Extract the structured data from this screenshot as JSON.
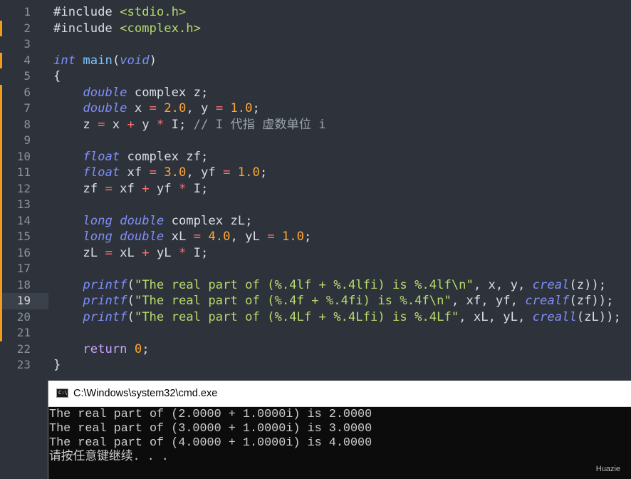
{
  "editor": {
    "current_line": "19",
    "lines": [
      {
        "num": "1",
        "marked": false,
        "tokens": [
          {
            "t": "#include ",
            "c": "pp"
          },
          {
            "t": "<stdio.h>",
            "c": "inc"
          }
        ]
      },
      {
        "num": "2",
        "marked": true,
        "tokens": [
          {
            "t": "#include ",
            "c": "pp"
          },
          {
            "t": "<complex.h>",
            "c": "inc"
          }
        ]
      },
      {
        "num": "3",
        "marked": false,
        "tokens": []
      },
      {
        "num": "4",
        "marked": true,
        "tokens": [
          {
            "t": "int",
            "c": "k"
          },
          {
            "t": " "
          },
          {
            "t": "main",
            "c": "fn"
          },
          {
            "t": "("
          },
          {
            "t": "void",
            "c": "k"
          },
          {
            "t": ")"
          }
        ]
      },
      {
        "num": "5",
        "marked": false,
        "tokens": [
          {
            "t": "{"
          }
        ]
      },
      {
        "num": "6",
        "marked": true,
        "tokens": [
          {
            "t": "    "
          },
          {
            "t": "double",
            "c": "k"
          },
          {
            "t": " complex z;"
          }
        ]
      },
      {
        "num": "7",
        "marked": true,
        "tokens": [
          {
            "t": "    "
          },
          {
            "t": "double",
            "c": "k"
          },
          {
            "t": " x "
          },
          {
            "t": "=",
            "c": "o"
          },
          {
            "t": " "
          },
          {
            "t": "2.0",
            "c": "n"
          },
          {
            "t": ", y "
          },
          {
            "t": "=",
            "c": "o"
          },
          {
            "t": " "
          },
          {
            "t": "1.0",
            "c": "n"
          },
          {
            "t": ";"
          }
        ]
      },
      {
        "num": "8",
        "marked": true,
        "tokens": [
          {
            "t": "    z "
          },
          {
            "t": "=",
            "c": "o"
          },
          {
            "t": " x "
          },
          {
            "t": "+",
            "c": "o"
          },
          {
            "t": " y "
          },
          {
            "t": "*",
            "c": "o"
          },
          {
            "t": " I; "
          },
          {
            "t": "// I 代指 虚数单位 i",
            "c": "cm"
          }
        ]
      },
      {
        "num": "9",
        "marked": true,
        "tokens": []
      },
      {
        "num": "10",
        "marked": true,
        "tokens": [
          {
            "t": "    "
          },
          {
            "t": "float",
            "c": "k"
          },
          {
            "t": " complex zf;"
          }
        ]
      },
      {
        "num": "11",
        "marked": true,
        "tokens": [
          {
            "t": "    "
          },
          {
            "t": "float",
            "c": "k"
          },
          {
            "t": " xf "
          },
          {
            "t": "=",
            "c": "o"
          },
          {
            "t": " "
          },
          {
            "t": "3.0",
            "c": "n"
          },
          {
            "t": ", yf "
          },
          {
            "t": "=",
            "c": "o"
          },
          {
            "t": " "
          },
          {
            "t": "1.0",
            "c": "n"
          },
          {
            "t": ";"
          }
        ]
      },
      {
        "num": "12",
        "marked": true,
        "tokens": [
          {
            "t": "    zf "
          },
          {
            "t": "=",
            "c": "o"
          },
          {
            "t": " xf "
          },
          {
            "t": "+",
            "c": "o"
          },
          {
            "t": " yf "
          },
          {
            "t": "*",
            "c": "o"
          },
          {
            "t": " I;"
          }
        ]
      },
      {
        "num": "13",
        "marked": true,
        "tokens": []
      },
      {
        "num": "14",
        "marked": true,
        "tokens": [
          {
            "t": "    "
          },
          {
            "t": "long",
            "c": "k"
          },
          {
            "t": " "
          },
          {
            "t": "double",
            "c": "k"
          },
          {
            "t": " complex zL;"
          }
        ]
      },
      {
        "num": "15",
        "marked": true,
        "tokens": [
          {
            "t": "    "
          },
          {
            "t": "long",
            "c": "k"
          },
          {
            "t": " "
          },
          {
            "t": "double",
            "c": "k"
          },
          {
            "t": " xL "
          },
          {
            "t": "=",
            "c": "o"
          },
          {
            "t": " "
          },
          {
            "t": "4.0",
            "c": "n"
          },
          {
            "t": ", yL "
          },
          {
            "t": "=",
            "c": "o"
          },
          {
            "t": " "
          },
          {
            "t": "1.0",
            "c": "n"
          },
          {
            "t": ";"
          }
        ]
      },
      {
        "num": "16",
        "marked": true,
        "tokens": [
          {
            "t": "    zL "
          },
          {
            "t": "=",
            "c": "o"
          },
          {
            "t": " xL "
          },
          {
            "t": "+",
            "c": "o"
          },
          {
            "t": " yL "
          },
          {
            "t": "*",
            "c": "o"
          },
          {
            "t": " I;"
          }
        ]
      },
      {
        "num": "17",
        "marked": true,
        "tokens": []
      },
      {
        "num": "18",
        "marked": true,
        "tokens": [
          {
            "t": "    "
          },
          {
            "t": "printf",
            "c": "k"
          },
          {
            "t": "("
          },
          {
            "t": "\"The real part of (%.4lf + %.4lfi) is %.4lf\\n\"",
            "c": "s"
          },
          {
            "t": ", x, y, "
          },
          {
            "t": "creal",
            "c": "k"
          },
          {
            "t": "(z));"
          }
        ]
      },
      {
        "num": "19",
        "marked": true,
        "tokens": [
          {
            "t": "    "
          },
          {
            "t": "printf",
            "c": "k"
          },
          {
            "t": "("
          },
          {
            "t": "\"The real part of (%.4f + %.4fi) is %.4f\\n\"",
            "c": "s"
          },
          {
            "t": ", xf, yf, "
          },
          {
            "t": "crealf",
            "c": "k"
          },
          {
            "t": "(zf));"
          }
        ]
      },
      {
        "num": "20",
        "marked": true,
        "tokens": [
          {
            "t": "    "
          },
          {
            "t": "printf",
            "c": "k"
          },
          {
            "t": "("
          },
          {
            "t": "\"The real part of (%.4Lf + %.4Lfi) is %.4Lf\"",
            "c": "s"
          },
          {
            "t": ", xL, yL, "
          },
          {
            "t": "creall",
            "c": "k"
          },
          {
            "t": "(zL));"
          }
        ]
      },
      {
        "num": "21",
        "marked": true,
        "tokens": []
      },
      {
        "num": "22",
        "marked": false,
        "tokens": [
          {
            "t": "    "
          },
          {
            "t": "return",
            "c": "ret"
          },
          {
            "t": " "
          },
          {
            "t": "0",
            "c": "n"
          },
          {
            "t": ";"
          }
        ]
      },
      {
        "num": "23",
        "marked": false,
        "tokens": [
          {
            "t": "}"
          }
        ]
      }
    ]
  },
  "console": {
    "icon_text": "C:\\",
    "title": "C:\\Windows\\system32\\cmd.exe",
    "output": [
      "The real part of (2.0000 + 1.0000i) is 2.0000",
      "The real part of (3.0000 + 1.0000i) is 3.0000",
      "The real part of (4.0000 + 1.0000i) is 4.0000",
      "请按任意键继续. . ."
    ]
  },
  "watermark": "Huazie",
  "colors": {
    "editor_bg": "#2e333b",
    "marker": "#f29c1c",
    "keyword": "#7f8ef7",
    "number": "#ffa631",
    "string": "#b6d96b",
    "operator": "#ff6e6e",
    "console_bg": "#0c0c0c"
  }
}
